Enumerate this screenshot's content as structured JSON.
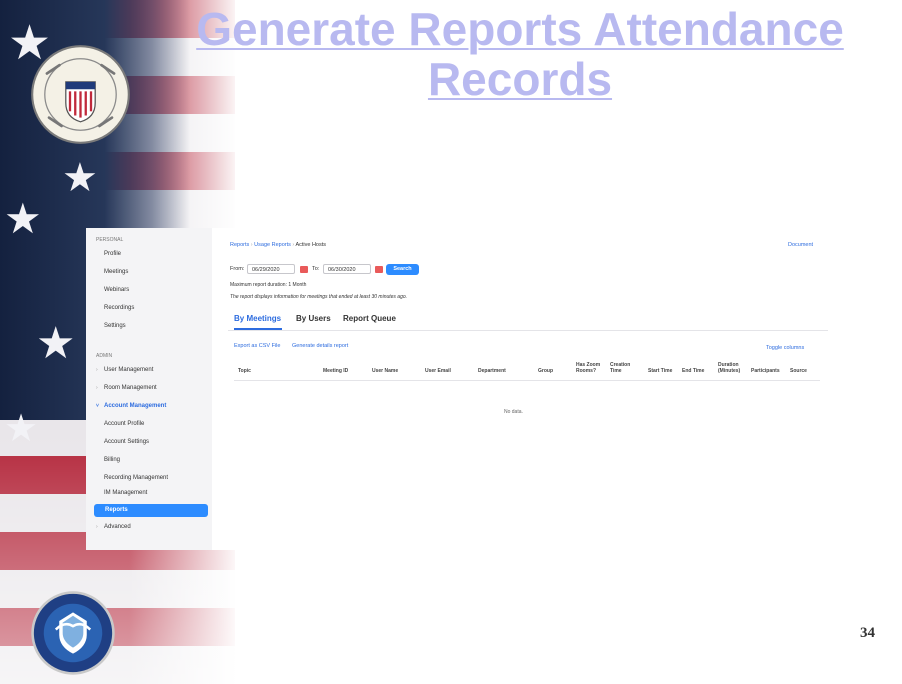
{
  "slide": {
    "title": "Generate Reports Attendance Records",
    "page_number": "34",
    "seal_top_text": "U.S. COAST GUARD AUXILIARY",
    "seal_bottom_text": "DEPARTMENT OF HOMELAND SECURITY"
  },
  "sidebar": {
    "personal_label": "PERSONAL",
    "personal_items": [
      "Profile",
      "Meetings",
      "Webinars",
      "Recordings",
      "Settings"
    ],
    "admin_label": "ADMIN",
    "admin_items": [
      "User Management",
      "Room Management",
      "Account Management"
    ],
    "account_sub_items": [
      "Account Profile",
      "Account Settings",
      "Billing",
      "Recording Management",
      "IM Management"
    ],
    "reports_label": "Reports",
    "advanced_label": "Advanced"
  },
  "main": {
    "breadcrumb": [
      "Reports",
      "Usage Reports",
      "Active Hosts"
    ],
    "document_link": "Document",
    "from_label": "From:",
    "from_date": "06/29/2020",
    "to_label": "To:",
    "to_date": "06/30/2020",
    "search_label": "Search",
    "max_duration": "Maximum report duration: 1 Month",
    "report_note": "The report displays information for meetings that ended at least 30 minutes ago.",
    "tabs": [
      "By Meetings",
      "By Users",
      "Report Queue"
    ],
    "export_link": "Export as CSV File",
    "generate_link": "Generate details report",
    "toggle_columns": "Toggle columns",
    "columns": [
      "Topic",
      "Meeting ID",
      "User Name",
      "User Email",
      "Department",
      "Group",
      "Has Zoom Rooms?",
      "Creation Time",
      "Start Time",
      "End Time",
      "Duration (Minutes)",
      "Participants",
      "Source"
    ],
    "empty_message": "No data."
  },
  "colors": {
    "title": "#b8b9f0",
    "accent": "#2d8cff",
    "link": "#2d6cdf"
  }
}
